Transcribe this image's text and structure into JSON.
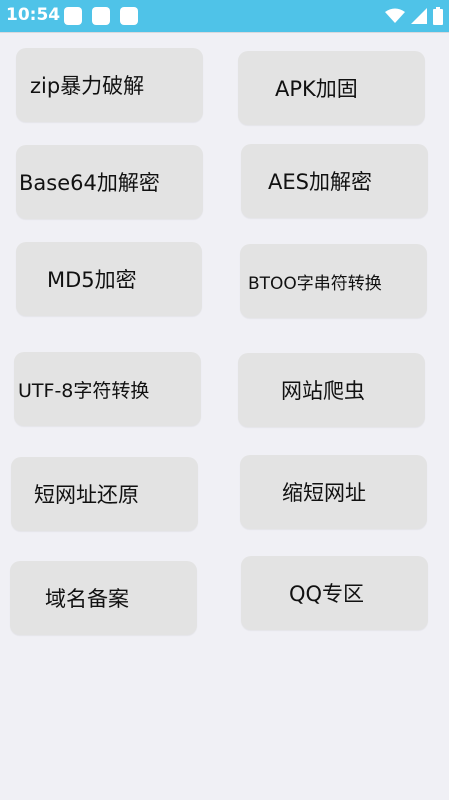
{
  "status_bar": {
    "time": "10:54",
    "notification_icons": [
      "app-notification-icon",
      "app-notification-icon",
      "app-notification-icon"
    ],
    "system_icons": [
      "wifi-icon",
      "cellular-signal-icon",
      "battery-icon"
    ],
    "accent_color": "#4fc3e8"
  },
  "buttons": [
    {
      "label": "zip暴力破解"
    },
    {
      "label": "APK加固"
    },
    {
      "label": "Base64加解密"
    },
    {
      "label": "AES加解密"
    },
    {
      "label": "MD5加密"
    },
    {
      "label": "BTOO字串符转换"
    },
    {
      "label": "UTF-8字符转换"
    },
    {
      "label": "网站爬虫"
    },
    {
      "label": "短网址还原"
    },
    {
      "label": "缩短网址"
    },
    {
      "label": "域名备案"
    },
    {
      "label": "QQ专区"
    }
  ]
}
